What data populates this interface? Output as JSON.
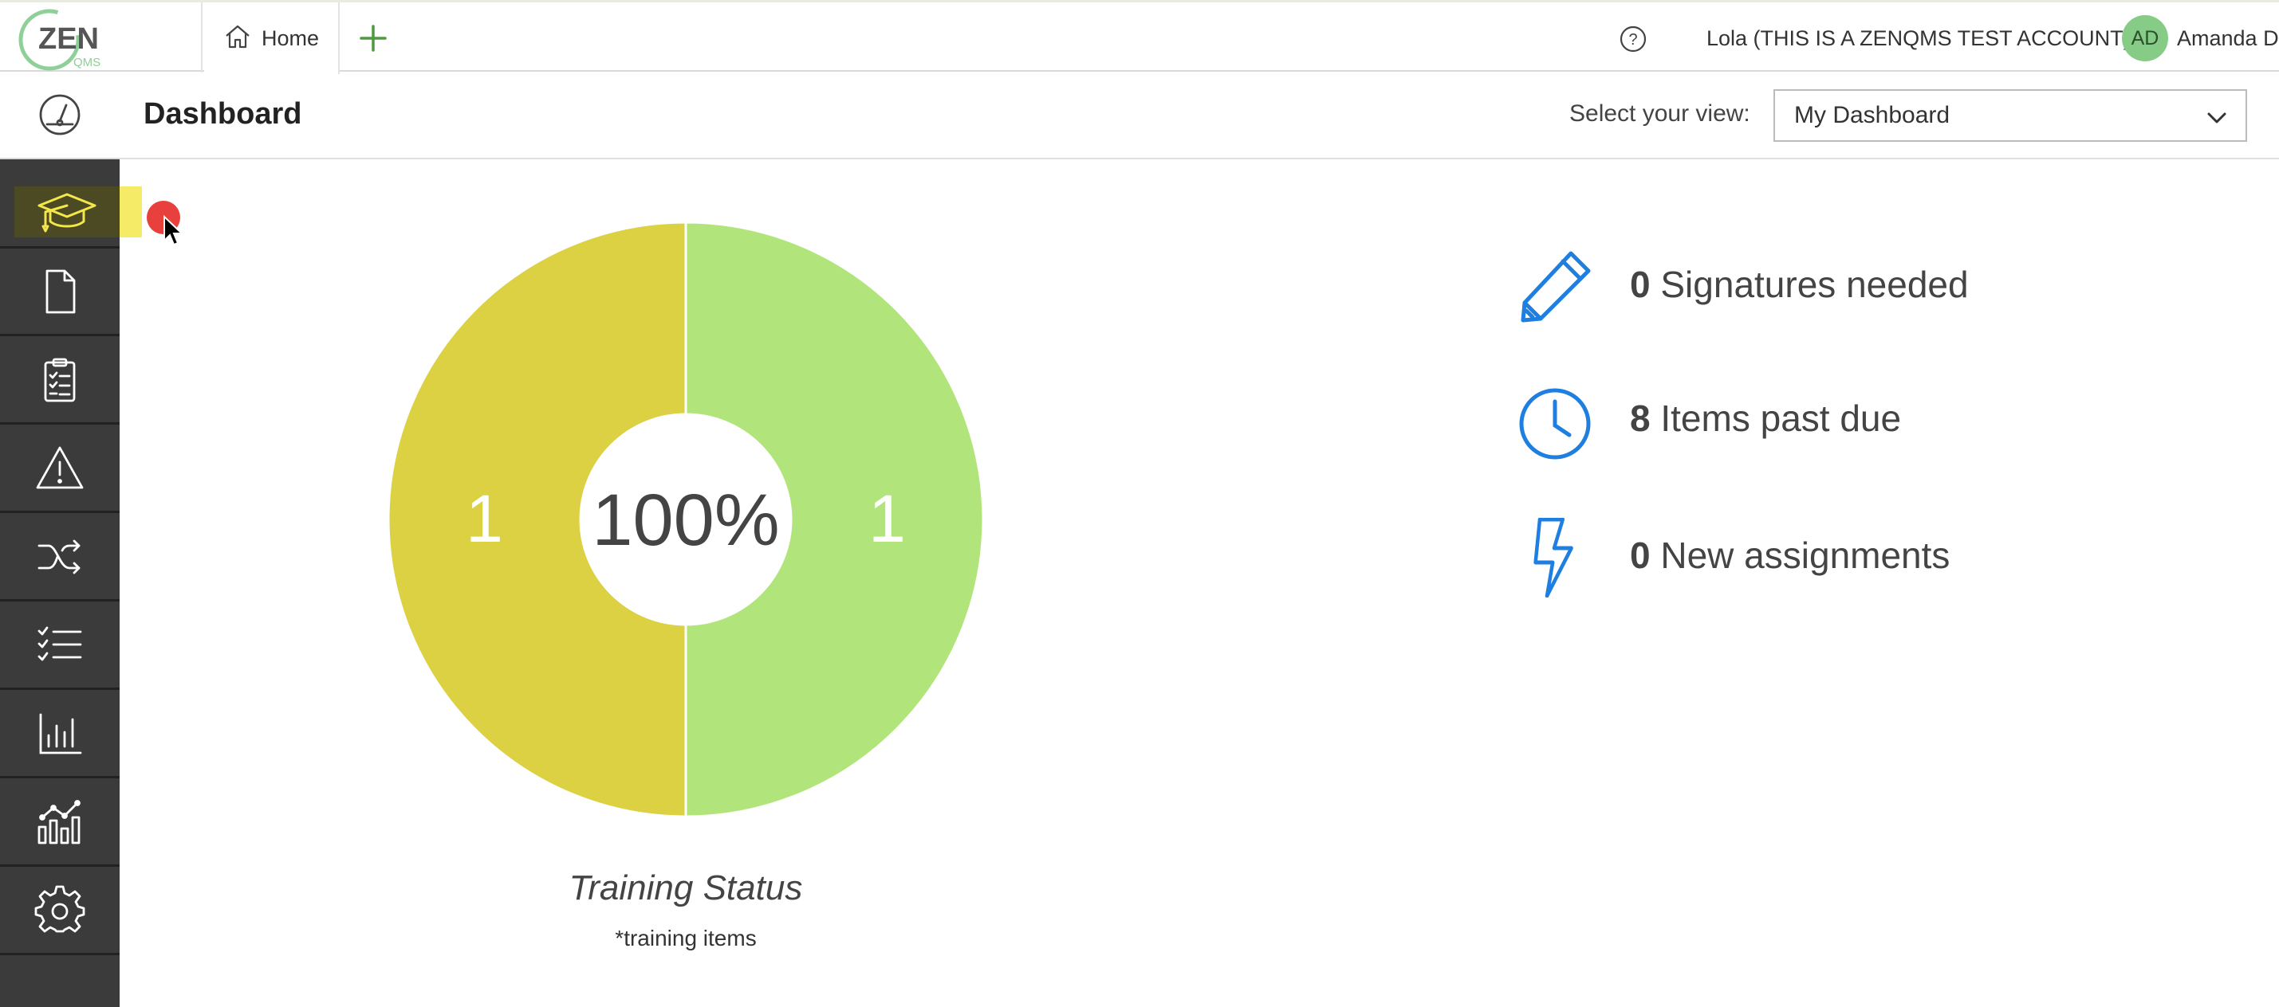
{
  "topbar": {
    "logo_text": "ZEN",
    "logo_sub": "QMS",
    "home_tab": "Home",
    "account": "Lola (THIS IS A ZENQMS TEST ACCOUNT)",
    "avatar_initials": "AD",
    "username": "Amanda D"
  },
  "sidebar": {
    "items": [
      {
        "icon": "dashboard-gauge-icon"
      },
      {
        "icon": "training-graduation-cap-icon",
        "active": true
      },
      {
        "icon": "document-icon"
      },
      {
        "icon": "clipboard-checklist-icon"
      },
      {
        "icon": "warning-triangle-icon"
      },
      {
        "icon": "shuffle-icon"
      },
      {
        "icon": "checklist-icon"
      },
      {
        "icon": "bar-chart-icon"
      },
      {
        "icon": "analytics-chart-icon"
      },
      {
        "icon": "settings-gear-icon"
      }
    ]
  },
  "header": {
    "title": "Dashboard",
    "view_label": "Select your view:",
    "view_value": "My Dashboard"
  },
  "chart_data": {
    "type": "pie",
    "title": "Training Status",
    "subtitle": "*training items",
    "center_label": "100%",
    "slices": [
      {
        "label": "1",
        "value": 1,
        "color": "#dbd143"
      },
      {
        "label": "1",
        "value": 1,
        "color": "#b1e57b"
      }
    ]
  },
  "stats": [
    {
      "icon": "pencil-icon",
      "count": "0",
      "label": "Signatures needed"
    },
    {
      "icon": "clock-icon",
      "count": "8",
      "label": "Items past due"
    },
    {
      "icon": "lightning-bolt-icon",
      "count": "0",
      "label": "New assignments"
    }
  ],
  "colors": {
    "sidebar_bg": "#3b3b3b",
    "active_highlight": "#f4e74c",
    "accent_blue": "#1f7fe0",
    "logo_green": "#7fc58a"
  }
}
